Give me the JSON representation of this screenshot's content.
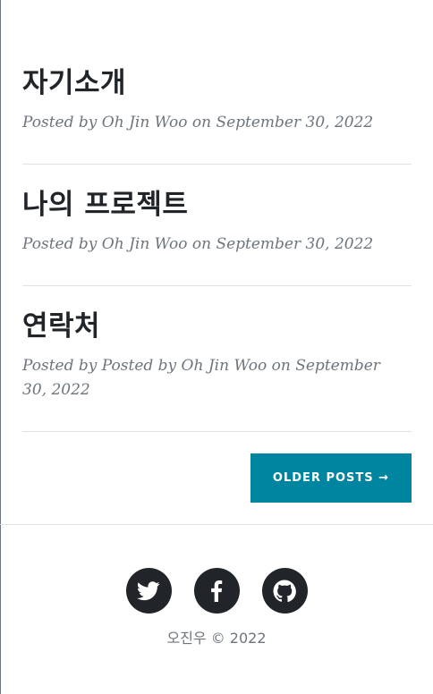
{
  "posts": [
    {
      "title": "자기소개",
      "meta": "Posted by Oh Jin Woo on September 30, 2022"
    },
    {
      "title": "나의 프로젝트",
      "meta": "Posted by Oh Jin Woo on September 30, 2022"
    },
    {
      "title": "연락처",
      "meta": "Posted by Posted by Oh Jin Woo on September 30, 2022"
    }
  ],
  "pager": {
    "older_label": "OLDER POSTS →"
  },
  "footer": {
    "social": [
      "twitter-icon",
      "facebook-icon",
      "github-icon"
    ],
    "copyright": "오진우 © 2022"
  },
  "colors": {
    "accent": "#0085a1",
    "text": "#212529",
    "muted": "#6c757d",
    "divider": "#dee2e6"
  }
}
